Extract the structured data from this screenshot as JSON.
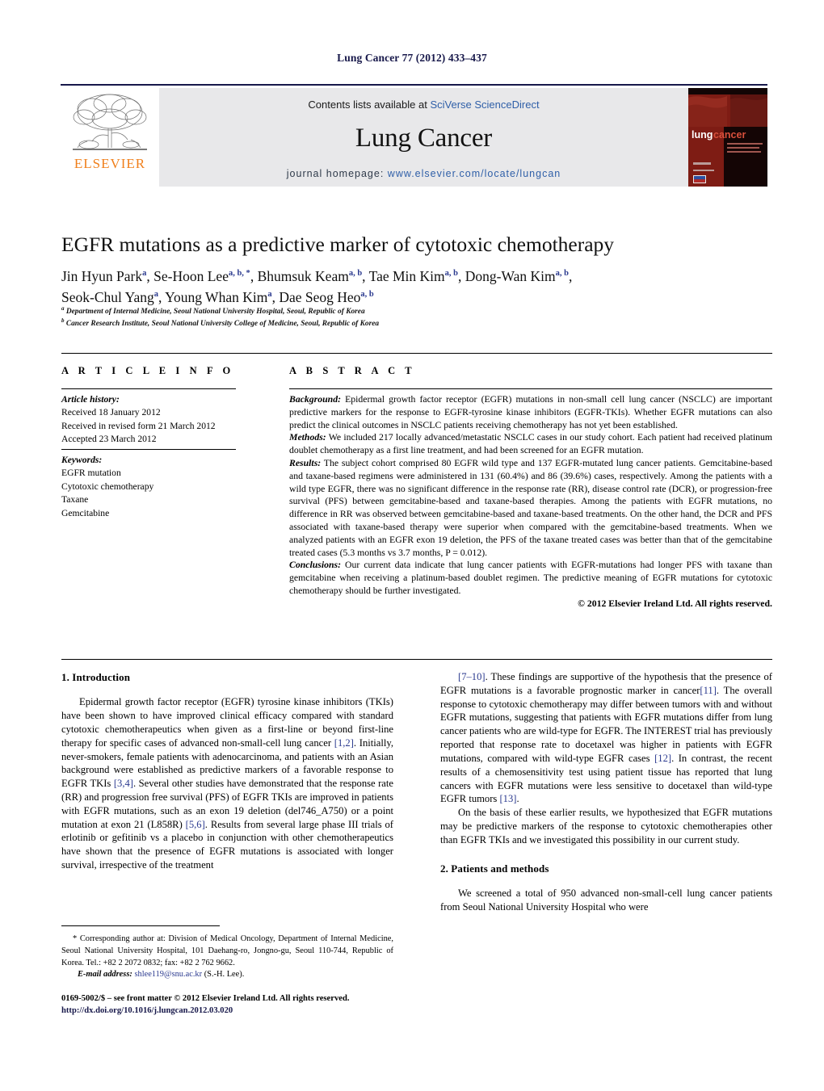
{
  "running_head": "Lung Cancer 77 (2012) 433–437",
  "masthead": {
    "contents_prefix": "Contents lists available at ",
    "contents_link": "SciVerse ScienceDirect",
    "journal_name": "Lung Cancer",
    "homepage_prefix": "journal homepage:",
    "homepage_url": "www.elsevier.com/locate/lungcan",
    "publisher_wordmark": "ELSEVIER",
    "cover_title_a": "lung",
    "cover_title_b": "cancer",
    "logo_icon": "elsevier-tree-logo",
    "colors": {
      "link": "#2f5fa8",
      "elsevier_orange": "#f07f1a",
      "banner_bg": "#e8e8ea",
      "rule": "#17184a",
      "cover_red": "#8f1313"
    }
  },
  "article": {
    "title": "EGFR mutations as a predictive marker of cytotoxic chemotherapy",
    "authors": [
      {
        "name": "Jin Hyun Park",
        "sup": "a"
      },
      {
        "name": "Se-Hoon Lee",
        "sup": "a, b, *"
      },
      {
        "name": "Bhumsuk Keam",
        "sup": "a, b"
      },
      {
        "name": "Tae Min Kim",
        "sup": "a, b"
      },
      {
        "name": "Dong-Wan Kim",
        "sup": "a, b"
      },
      {
        "name": "Seok-Chul Yang",
        "sup": "a"
      },
      {
        "name": "Young Whan Kim",
        "sup": "a"
      },
      {
        "name": "Dae Seog Heo",
        "sup": "a, b"
      }
    ],
    "affiliations": [
      {
        "marker": "a",
        "text": "Department of Internal Medicine, Seoul National University Hospital, Seoul, Republic of Korea"
      },
      {
        "marker": "b",
        "text": "Cancer Research Institute, Seoul National University College of Medicine, Seoul, Republic of Korea"
      }
    ]
  },
  "article_info": {
    "heading": "A R T I C L E   I N F O",
    "history_label": "Article history:",
    "history": [
      "Received 18 January 2012",
      "Received in revised form 21 March 2012",
      "Accepted 23 March 2012"
    ],
    "keywords_label": "Keywords:",
    "keywords": [
      "EGFR mutation",
      "Cytotoxic chemotherapy",
      "Taxane",
      "Gemcitabine"
    ]
  },
  "abstract": {
    "heading": "A B S T R A C T",
    "sections": [
      {
        "label": "Background:",
        "text": " Epidermal growth factor receptor (EGFR) mutations in non-small cell lung cancer (NSCLC) are important predictive markers for the response to EGFR-tyrosine kinase inhibitors (EGFR-TKIs). Whether EGFR mutations can also predict the clinical outcomes in NSCLC patients receiving chemotherapy has not yet been established."
      },
      {
        "label": "Methods:",
        "text": " We included 217 locally advanced/metastatic NSCLC cases in our study cohort. Each patient had received platinum doublet chemotherapy as a first line treatment, and had been screened for an EGFR mutation."
      },
      {
        "label": "Results:",
        "text": " The subject cohort comprised 80 EGFR wild type and 137 EGFR-mutated lung cancer patients. Gemcitabine-based and taxane-based regimens were administered in 131 (60.4%) and 86 (39.6%) cases, respectively. Among the patients with a wild type EGFR, there was no significant difference in the response rate (RR), disease control rate (DCR), or progression-free survival (PFS) between gemcitabine-based and taxane-based therapies. Among the patients with EGFR mutations, no difference in RR was observed between gemcitabine-based and taxane-based treatments. On the other hand, the DCR and PFS associated with taxane-based therapy were superior when compared with the gemcitabine-based treatments. When we analyzed patients with an EGFR exon 19 deletion, the PFS of the taxane treated cases was better than that of the gemcitabine treated cases (5.3 months vs 3.7 months, P = 0.012)."
      },
      {
        "label": "Conclusions:",
        "text": " Our current data indicate that lung cancer patients with EGFR-mutations had longer PFS with taxane than gemcitabine when receiving a platinum-based doublet regimen. The predictive meaning of EGFR mutations for cytotoxic chemotherapy should be further investigated."
      }
    ],
    "copyright": "© 2012 Elsevier Ireland Ltd. All rights reserved."
  },
  "body": {
    "intro_heading": "1.  Introduction",
    "intro_p1_a": "Epidermal growth factor receptor (EGFR) tyrosine kinase inhibitors (TKIs) have been shown to have improved clinical efficacy compared with standard cytotoxic chemotherapeutics when given as a first-line or beyond first-line therapy for specific cases of advanced non-small-cell lung cancer ",
    "ref_1_2": "[1,2]",
    "intro_p1_b": ". Initially, never-smokers, female patients with adenocarcinoma, and patients with an Asian background were established as predictive markers of a favorable response to EGFR TKIs ",
    "ref_3_4": "[3,4]",
    "intro_p1_c": ". Several other studies have demonstrated that the response rate (RR) and progression free survival (PFS) of EGFR TKIs are improved in patients with EGFR mutations, such as an exon 19 deletion (del746_A750) or a point mutation at exon 21 (L858R) ",
    "ref_5_6": "[5,6]",
    "intro_p1_d": ". Results from several large phase III trials of erlotinib or gefitinib vs a placebo in conjunction with other chemotherapeutics have shown that the presence of EGFR mutations is associated with longer survival, irrespective of the treatment ",
    "ref_7_10": "[7–10]",
    "intro_p1_e": ". These findings are supportive of the hypothesis that the presence of EGFR mutations is a favorable prognostic marker in cancer",
    "ref_11": "[11]",
    "intro_p1_f": ". The overall response to cytotoxic chemotherapy may differ between tumors with and without EGFR mutations, suggesting that patients with EGFR mutations differ from lung cancer patients who are wild-type for EGFR. The INTEREST trial has previously reported that response rate to docetaxel was higher in patients with EGFR mutations, compared with wild-type EGFR cases ",
    "ref_12": "[12]",
    "intro_p1_g": ". In contrast, the recent results of a chemosensitivity test using patient tissue has reported that lung cancers with EGFR mutations were less sensitive to docetaxel than wild-type EGFR tumors ",
    "ref_13": "[13]",
    "intro_p1_h": ".",
    "intro_p2": "On the basis of these earlier results, we hypothesized that EGFR mutations may be predictive markers of the response to cytotoxic chemotherapies other than EGFR TKIs and we investigated this possibility in our current study.",
    "methods_heading": "2.  Patients and methods",
    "methods_p1": "We screened a total of 950 advanced non-small-cell lung cancer patients from Seoul National University Hospital who were"
  },
  "footnote": {
    "corresponding": "* Corresponding author at: Division of Medical Oncology, Department of Internal Medicine, Seoul National University Hospital, 101 Daehang-ro, Jongno-gu, Seoul 110-744, Republic of Korea. Tel.: +82 2 2072 0832; fax: +82 2 762 9662.",
    "email_label": "E-mail address:",
    "email": "shlee119@snu.ac.kr",
    "email_owner": "(S.-H. Lee).",
    "imprint": "0169-5002/$ – see front matter © 2012 Elsevier Ireland Ltd. All rights reserved.",
    "doi": "http://dx.doi.org/10.1016/j.lungcan.2012.03.020"
  }
}
